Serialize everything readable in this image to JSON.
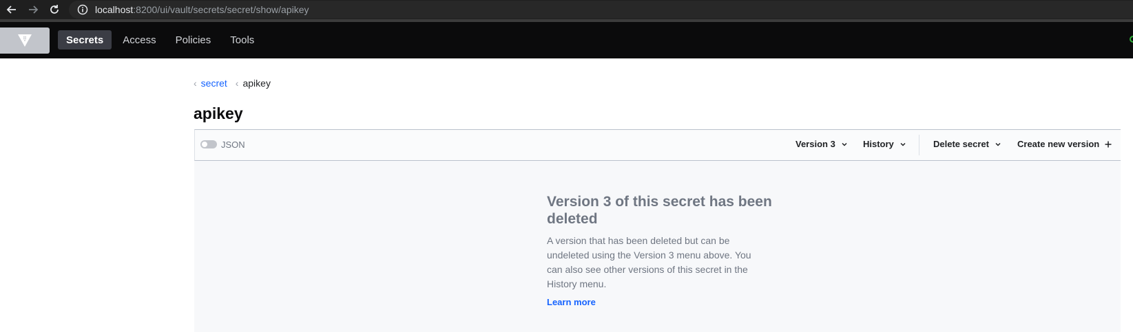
{
  "browser": {
    "url_host": "localhost",
    "url_rest": ":8200/ui/vault/secrets/secret/show/apikey"
  },
  "header": {
    "nav": [
      {
        "label": "Secrets",
        "active": true
      },
      {
        "label": "Access",
        "active": false
      },
      {
        "label": "Policies",
        "active": false
      },
      {
        "label": "Tools",
        "active": false
      }
    ]
  },
  "breadcrumb": {
    "parent": "secret",
    "current": "apikey"
  },
  "page": {
    "title": "apikey"
  },
  "toolbar": {
    "json_toggle_label": "JSON",
    "json_toggle_on": false,
    "version_label": "Version 3",
    "history_label": "History",
    "delete_label": "Delete secret",
    "create_label": "Create new version"
  },
  "empty_state": {
    "title": "Version 3 of this secret has been deleted",
    "body": "A version that has been deleted but can be undeleted using the Version 3 menu above. You can also see other versions of this secret in the History menu.",
    "link": "Learn more"
  },
  "colors": {
    "accent": "#1563ff",
    "header_bg": "#0b0b0c",
    "status": "#2eb039"
  }
}
